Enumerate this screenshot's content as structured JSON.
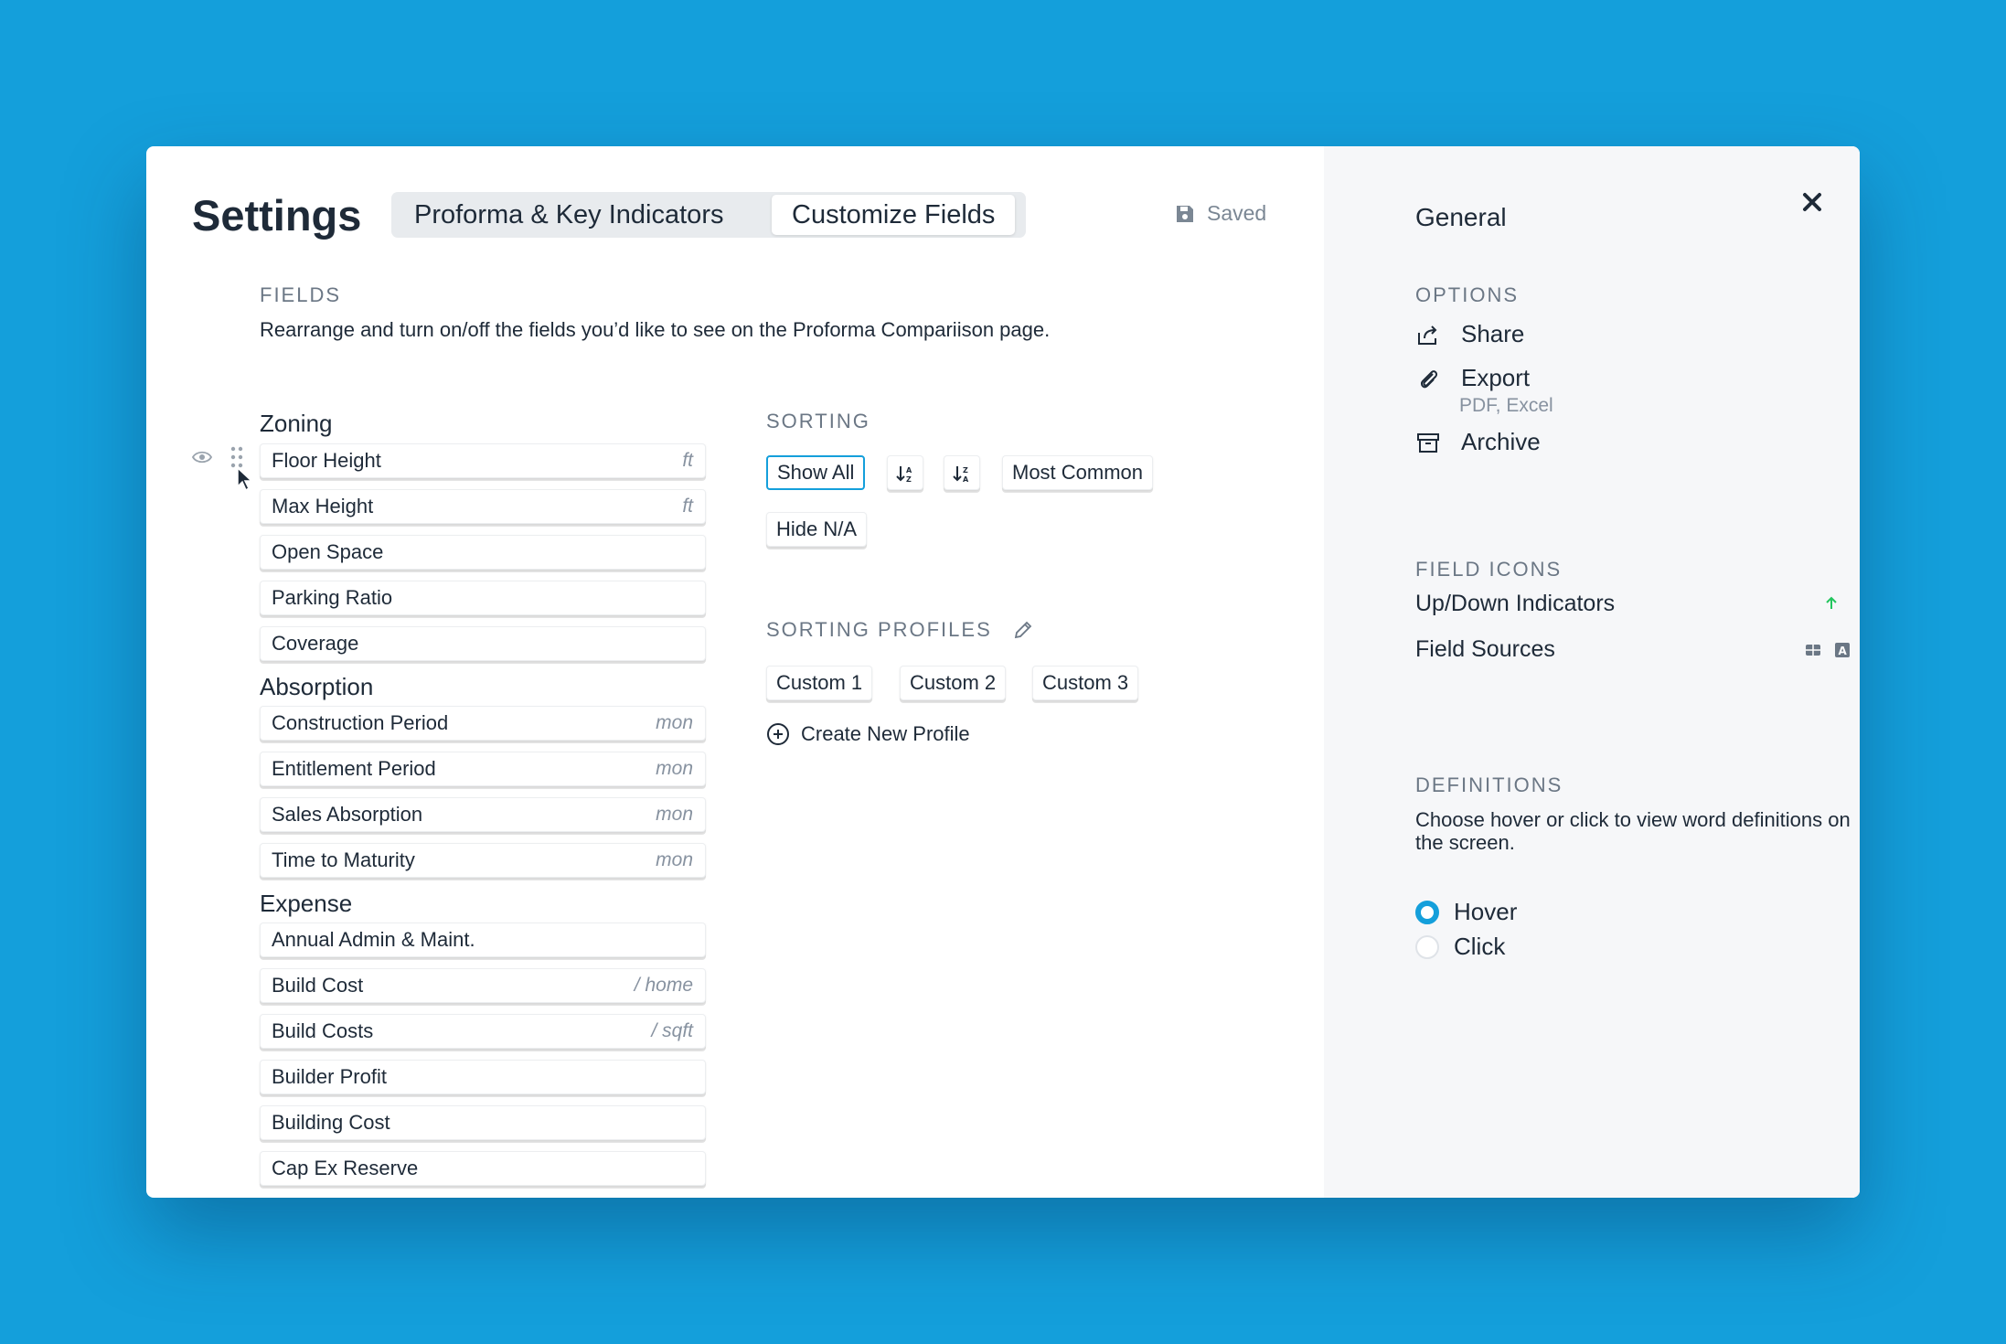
{
  "header": {
    "title": "Settings",
    "tabs": [
      {
        "label": "Proforma & Key Indicators",
        "active": false
      },
      {
        "label": "Customize Fields",
        "active": true
      }
    ],
    "saved_label": "Saved"
  },
  "fields": {
    "label": "FIELDS",
    "description": "Rearrange and turn on/off the fields you’d like to see on the Proforma Compariison page.",
    "groups": [
      {
        "title": "Zoning",
        "items": [
          {
            "name": "Floor Height",
            "unit": "ft"
          },
          {
            "name": "Max Height",
            "unit": "ft"
          },
          {
            "name": "Open Space",
            "unit": ""
          },
          {
            "name": "Parking Ratio",
            "unit": ""
          },
          {
            "name": "Coverage",
            "unit": ""
          }
        ]
      },
      {
        "title": "Absorption",
        "items": [
          {
            "name": "Construction Period",
            "unit": "mon"
          },
          {
            "name": "Entitlement Period",
            "unit": "mon"
          },
          {
            "name": "Sales Absorption",
            "unit": "mon"
          },
          {
            "name": "Time to Maturity",
            "unit": "mon"
          }
        ]
      },
      {
        "title": "Expense",
        "items": [
          {
            "name": "Annual Admin & Maint.",
            "unit": ""
          },
          {
            "name": "Build Cost",
            "unit": "/ home"
          },
          {
            "name": "Build Costs",
            "unit": "/ sqft"
          },
          {
            "name": "Builder Profit",
            "unit": ""
          },
          {
            "name": "Building Cost",
            "unit": ""
          },
          {
            "name": "Cap Ex Reserve",
            "unit": ""
          }
        ]
      }
    ]
  },
  "sorting": {
    "label": "SORTING",
    "show_all": "Show All",
    "most_common": "Most Common",
    "hide_na": "Hide N/A",
    "profiles_label": "SORTING PROFILES",
    "profiles": [
      "Custom 1",
      "Custom 2",
      "Custom 3"
    ],
    "create_label": "Create New Profile"
  },
  "panel": {
    "title": "General",
    "options_label": "OPTIONS",
    "share": "Share",
    "export": "Export",
    "export_sub": "PDF, Excel",
    "archive": "Archive",
    "field_icons_label": "FIELD ICONS",
    "updown_label": "Up/Down Indicators",
    "sources_label": "Field Sources",
    "definitions_label": "DEFINITIONS",
    "definitions_desc": "Choose hover or click to view word definitions on the screen.",
    "hover": "Hover",
    "click": "Click",
    "accent_color": "#149fdb",
    "up_color": "#22c55e",
    "down_color": "#ef4444"
  }
}
